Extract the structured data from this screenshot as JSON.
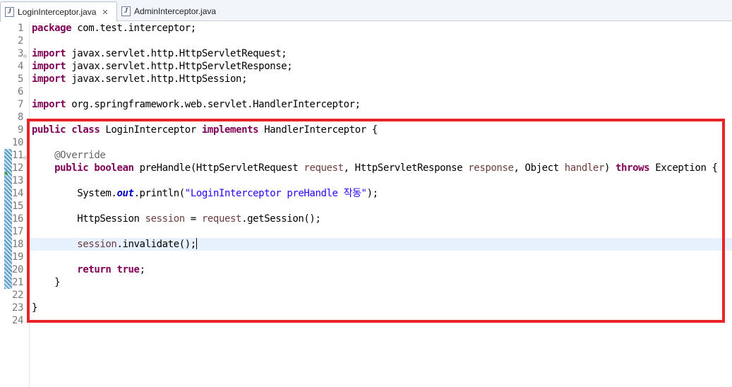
{
  "tabs": [
    {
      "label": "LoginInterceptor.java",
      "active": true,
      "icon": "java-file-icon"
    },
    {
      "label": "AdminInterceptor.java",
      "active": false,
      "icon": "java-file-icon"
    }
  ],
  "colors": {
    "keyword": "#7f0055",
    "string": "#2a00ff",
    "annotation": "#646464",
    "parameter": "#6a3e3e",
    "static_field": "#0000c0",
    "highlight_box": "#e8232a",
    "current_line": "#e8f2fe"
  },
  "current_line_number": "18",
  "editor": {
    "lines": [
      {
        "n": "1",
        "tokens": [
          {
            "t": "package",
            "c": "kw"
          },
          {
            "t": " com.test.interceptor;"
          }
        ]
      },
      {
        "n": "2",
        "tokens": []
      },
      {
        "n": "3",
        "fold": true,
        "tokens": [
          {
            "t": "import",
            "c": "kw"
          },
          {
            "t": " javax.servlet.http.HttpServletRequest;"
          }
        ]
      },
      {
        "n": "4",
        "tokens": [
          {
            "t": "import",
            "c": "kw"
          },
          {
            "t": " javax.servlet.http.HttpServletResponse;"
          }
        ]
      },
      {
        "n": "5",
        "tokens": [
          {
            "t": "import",
            "c": "kw"
          },
          {
            "t": " javax.servlet.http.HttpSession;"
          }
        ]
      },
      {
        "n": "6",
        "tokens": []
      },
      {
        "n": "7",
        "tokens": [
          {
            "t": "import",
            "c": "kw"
          },
          {
            "t": " org.springframework.web.servlet.HandlerInterceptor;"
          }
        ]
      },
      {
        "n": "8",
        "tokens": []
      },
      {
        "n": "9",
        "tokens": [
          {
            "t": "public",
            "c": "kw"
          },
          {
            "t": " "
          },
          {
            "t": "class",
            "c": "kw"
          },
          {
            "t": " LoginInterceptor "
          },
          {
            "t": "implements",
            "c": "kw"
          },
          {
            "t": " HandlerInterceptor {"
          }
        ]
      },
      {
        "n": "10",
        "tokens": []
      },
      {
        "n": "11",
        "fold": true,
        "tokens": [
          {
            "t": "    "
          },
          {
            "t": "@Override",
            "c": "ann"
          }
        ]
      },
      {
        "n": "12",
        "override": true,
        "tokens": [
          {
            "t": "    "
          },
          {
            "t": "public",
            "c": "kw"
          },
          {
            "t": " "
          },
          {
            "t": "boolean",
            "c": "kw"
          },
          {
            "t": " preHandle(HttpServletRequest "
          },
          {
            "t": "request",
            "c": "param"
          },
          {
            "t": ", HttpServletResponse "
          },
          {
            "t": "response",
            "c": "param"
          },
          {
            "t": ", Object "
          },
          {
            "t": "handler",
            "c": "param"
          },
          {
            "t": ") "
          },
          {
            "t": "throws",
            "c": "kw"
          },
          {
            "t": " Exception {"
          }
        ]
      },
      {
        "n": "13",
        "tokens": []
      },
      {
        "n": "14",
        "tokens": [
          {
            "t": "        System."
          },
          {
            "t": "out",
            "c": "static"
          },
          {
            "t": ".println("
          },
          {
            "t": "\"LoginInterceptor preHandle 작동\"",
            "c": "str"
          },
          {
            "t": ");"
          }
        ]
      },
      {
        "n": "15",
        "tokens": []
      },
      {
        "n": "16",
        "tokens": [
          {
            "t": "        HttpSession "
          },
          {
            "t": "session",
            "c": "param"
          },
          {
            "t": " = "
          },
          {
            "t": "request",
            "c": "param"
          },
          {
            "t": ".getSession();"
          }
        ]
      },
      {
        "n": "17",
        "tokens": []
      },
      {
        "n": "18",
        "caret": true,
        "tokens": [
          {
            "t": "        "
          },
          {
            "t": "session",
            "c": "param"
          },
          {
            "t": ".invalidate();"
          }
        ]
      },
      {
        "n": "19",
        "tokens": []
      },
      {
        "n": "20",
        "tokens": [
          {
            "t": "        "
          },
          {
            "t": "return",
            "c": "kw"
          },
          {
            "t": " "
          },
          {
            "t": "true",
            "c": "kw"
          },
          {
            "t": ";"
          }
        ]
      },
      {
        "n": "21",
        "tokens": [
          {
            "t": "    }"
          }
        ]
      },
      {
        "n": "22",
        "tokens": []
      },
      {
        "n": "23",
        "tokens": [
          {
            "t": "}"
          }
        ]
      },
      {
        "n": "24",
        "tokens": []
      }
    ]
  }
}
